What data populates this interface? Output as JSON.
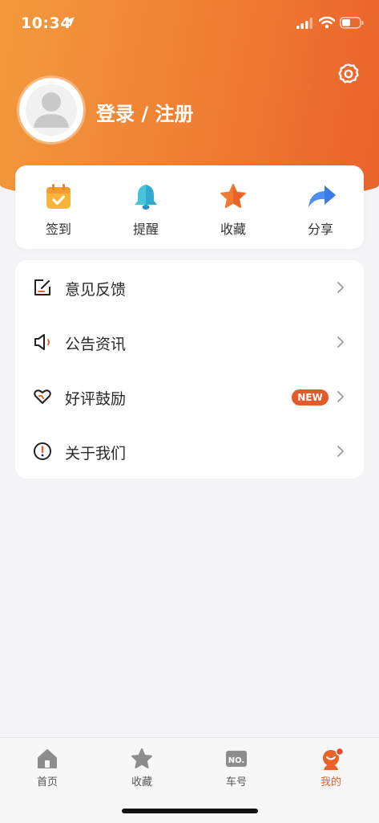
{
  "status_bar": {
    "time": "10:34"
  },
  "header": {
    "login_text": "登录 / 注册"
  },
  "quick_actions": [
    {
      "label": "签到",
      "icon": "calendar-check-icon"
    },
    {
      "label": "提醒",
      "icon": "bell-icon"
    },
    {
      "label": "收藏",
      "icon": "star-icon"
    },
    {
      "label": "分享",
      "icon": "share-arrow-icon"
    }
  ],
  "menu": [
    {
      "label": "意见反馈",
      "icon": "edit-icon"
    },
    {
      "label": "公告资讯",
      "icon": "speaker-icon"
    },
    {
      "label": "好评鼓励",
      "icon": "heart-icon",
      "badge": "NEW"
    },
    {
      "label": "关于我们",
      "icon": "info-icon"
    }
  ],
  "tabs": [
    {
      "label": "首页",
      "icon": "home-icon"
    },
    {
      "label": "收藏",
      "icon": "star-icon"
    },
    {
      "label": "车号",
      "icon": "number-plate-icon"
    },
    {
      "label": "我的",
      "icon": "profile-icon",
      "active": true
    }
  ],
  "colors": {
    "accent": "#e8622a",
    "header_start": "#f39a3d",
    "header_end": "#ea622b"
  }
}
